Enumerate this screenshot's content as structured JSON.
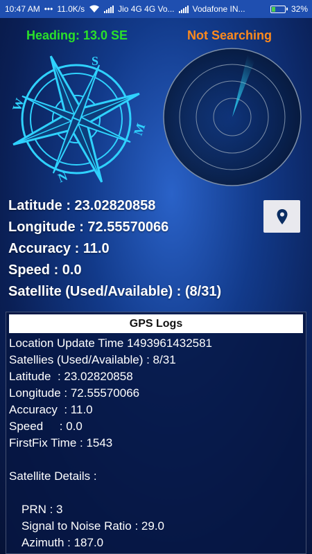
{
  "status_bar": {
    "time": "10:47 AM",
    "net_speed": "11.0K/s",
    "carrier1": "Jio 4G 4G Vo...",
    "carrier2": "Vodafone IN...",
    "battery": "32%",
    "battery_level": 0.32
  },
  "header": {
    "heading": "Heading: 13.0 SE",
    "search_status": "Not Searching"
  },
  "colors": {
    "heading": "#2ae02a",
    "search_status": "#ff8a1c",
    "compass": "#2fd2ff"
  },
  "compass_letters": {
    "s": "S",
    "w": "W",
    "n": "N",
    "e": "M"
  },
  "info": {
    "latitude": "Latitude : 23.02820858",
    "longitude": "Longitude : 72.55570066",
    "accuracy": "Accuracy : 11.0",
    "speed": "Speed : 0.0",
    "satellite": "Satellite (Used/Available) : (8/31)"
  },
  "logs": {
    "title": "GPS Logs",
    "lines": [
      "Location Update Time 1493961432581",
      "Satellies (Used/Available) : 8/31",
      "Latitude  : 23.02820858",
      "Longitude : 72.55570066",
      "Accuracy  : 11.0",
      "Speed     : 0.0",
      "FirstFix Time : 1543",
      "",
      "Satellite Details :",
      ""
    ],
    "details": [
      "PRN : 3",
      "Signal to Noise Ratio : 29.0",
      "Azimuth : 187.0"
    ]
  },
  "icons": {
    "wifi": "wifi-icon",
    "location": "map-pin-icon",
    "battery": "battery-icon"
  }
}
